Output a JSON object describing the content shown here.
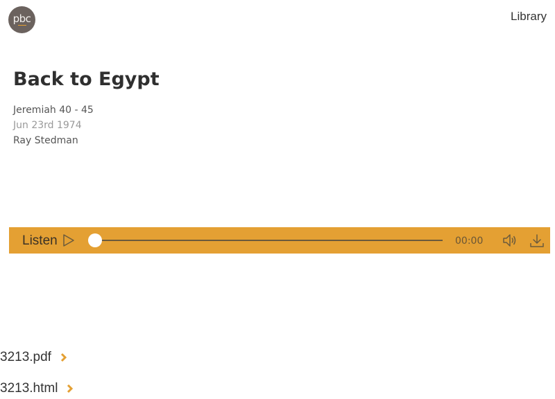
{
  "header": {
    "logo_text": "pbc",
    "nav_library": "Library"
  },
  "sermon": {
    "title": "Back to Egypt",
    "scripture": "Jeremiah 40 - 45",
    "date": "Jun 23rd 1974",
    "author": "Ray Stedman"
  },
  "player": {
    "listen_label": "Listen",
    "time": "00:00",
    "progress": 0,
    "accent_color": "#e4a033"
  },
  "files": [
    {
      "label": "3213.pdf"
    },
    {
      "label": "3213.html"
    }
  ],
  "icons": {
    "play": "play-icon",
    "volume": "volume-icon",
    "download": "download-icon",
    "chevron": "chevron-right-icon"
  }
}
